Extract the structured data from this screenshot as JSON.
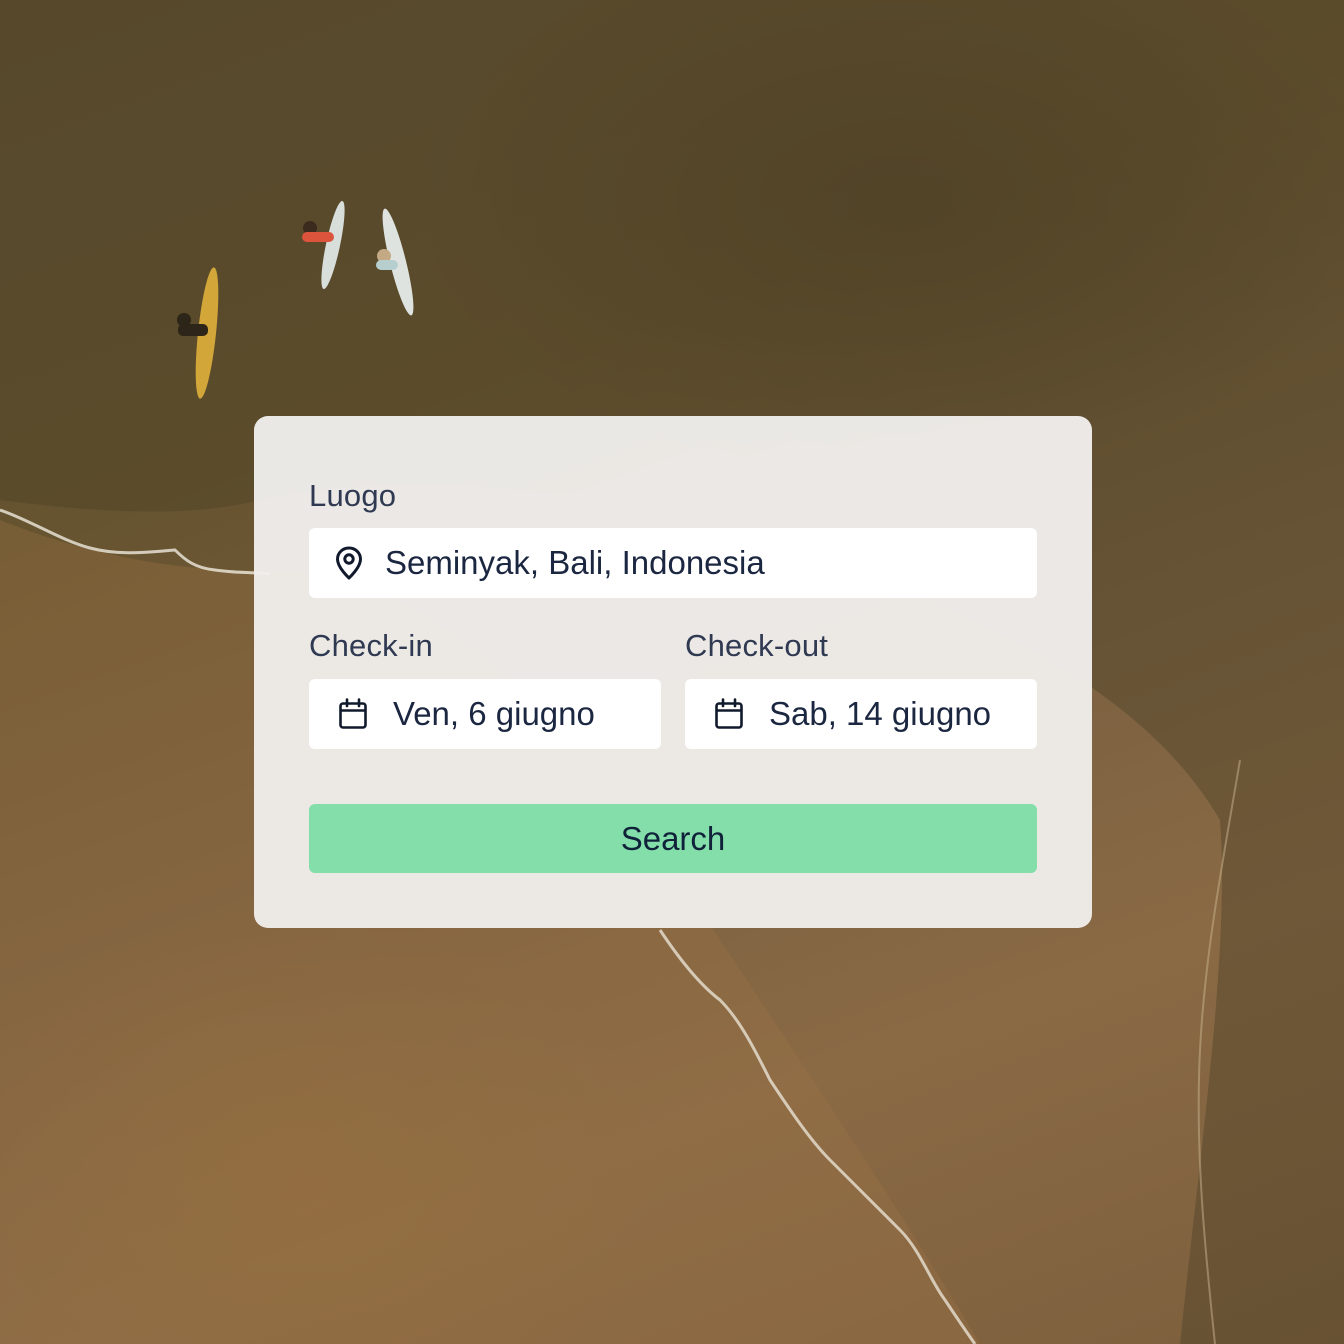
{
  "background": {
    "description_icon": "beach-aerial-photo"
  },
  "form": {
    "location": {
      "label": "Luogo",
      "value": "Seminyak, Bali, Indonesia",
      "icon": "map-pin-icon"
    },
    "checkin": {
      "label": "Check-in",
      "value": "Ven, 6 giugno",
      "icon": "calendar-icon"
    },
    "checkout": {
      "label": "Check-out",
      "value": "Sab, 14 giugno",
      "icon": "calendar-icon"
    },
    "search_label": "Search"
  },
  "colors": {
    "button": "#84dea9",
    "text": "#1b2740",
    "label": "#2f3a52",
    "card": "#f0eeec"
  }
}
